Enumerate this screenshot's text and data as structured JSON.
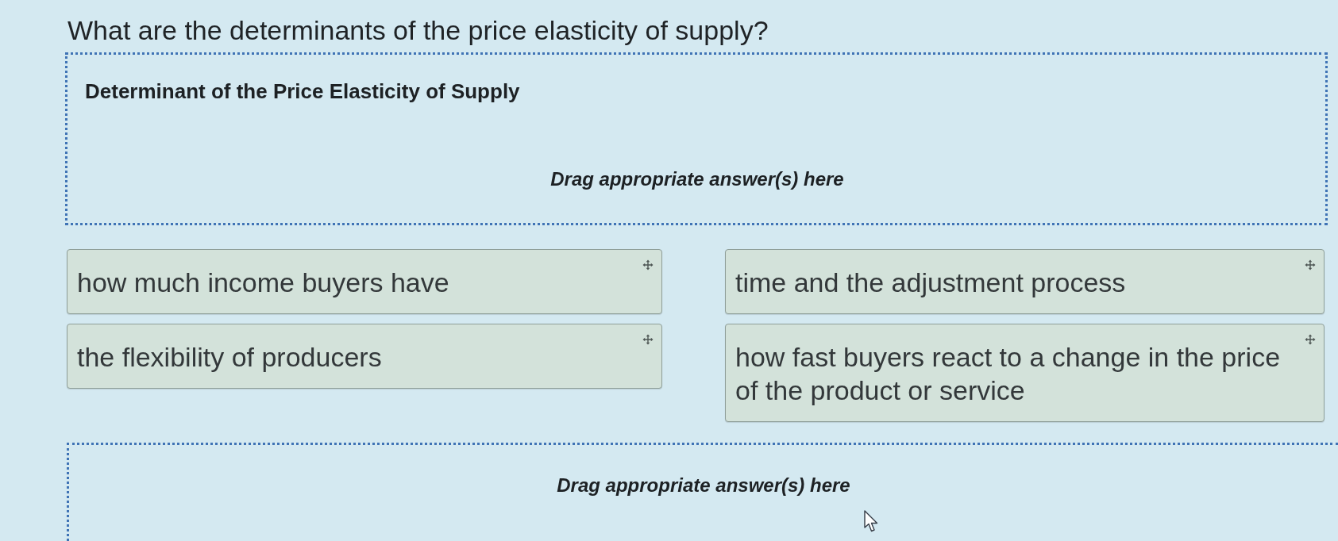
{
  "question": "What are the determinants of the price elasticity of supply?",
  "top_drop_zone": {
    "heading": "Determinant of the Price Elasticity of Supply",
    "hint": "Drag appropriate answer(s) here"
  },
  "answer_columns": [
    {
      "answers": [
        "how much income buyers have",
        "the flexibility of producers"
      ]
    },
    {
      "answers": [
        "time and the adjustment process",
        "how fast buyers react to a change in the price of the product or service"
      ]
    }
  ],
  "bottom_drop_zone": {
    "hint": "Drag appropriate answer(s) here"
  }
}
